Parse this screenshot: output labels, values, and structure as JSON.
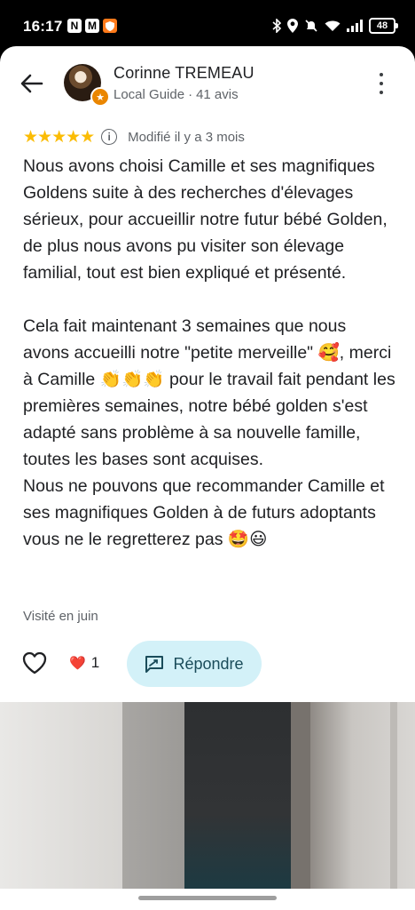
{
  "status_bar": {
    "time": "16:17",
    "left_icons": [
      "N",
      "M",
      "shield"
    ],
    "battery": "48"
  },
  "review": {
    "reviewer_name": "Corinne TREMEAU",
    "reviewer_level": "Local Guide",
    "separator": "·",
    "reviewer_reviews": "41 avis",
    "rating": 5,
    "stars": "★★★★★",
    "modified": "Modifié il y a 3 mois",
    "text": "Nous avons choisi Camille et ses magnifiques Goldens suite à des recherches d'élevages sérieux, pour accueillir notre futur bébé Golden, de plus nous avons pu visiter son élevage familial, tout est bien expliqué et présenté.\n\nCela fait maintenant 3 semaines que nous avons accueilli notre \"petite merveille\" 🥰, merci à Camille 👏👏👏 pour le travail fait pendant les  premières semaines, notre bébé golden s'est adapté sans problème à sa nouvelle famille, toutes les bases sont acquises.\nNous ne pouvons que recommander Camille et ses magnifiques Golden à de futurs adoptants vous ne le regretterez pas 🤩😃",
    "visited": "Visité en juin"
  },
  "actions": {
    "like_count": "1",
    "heart_emoji": "❤️",
    "reply_label": "Répondre"
  },
  "colors": {
    "star": "#fbbc04",
    "reply_bg": "#d3f1f8",
    "reply_text": "#1a4c5a"
  },
  "icons": {
    "back": "arrow-back-icon",
    "menu": "more-vert-icon",
    "info": "info-icon",
    "like": "heart-outline-icon",
    "reply": "reply-icon"
  }
}
